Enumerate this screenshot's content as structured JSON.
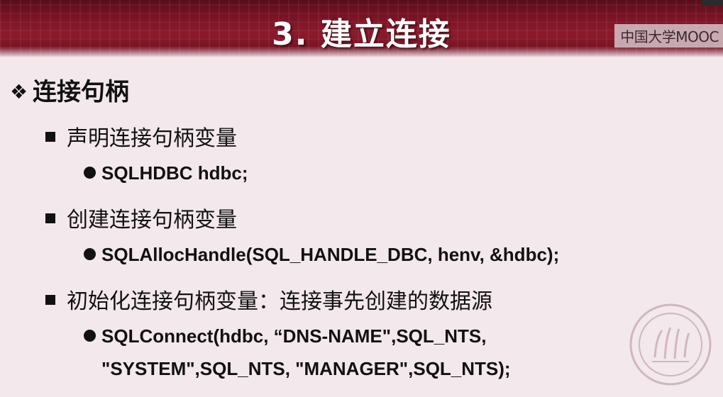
{
  "slide": {
    "title": "3. 建立连接",
    "watermark": "中国大学MOOC",
    "heading": "连接句柄",
    "items": [
      {
        "text": "声明连接句柄变量",
        "sub": [
          "SQLHDBC hdbc;"
        ]
      },
      {
        "text": "创建连接句柄变量",
        "sub": [
          "SQLAllocHandle(SQL_HANDLE_DBC, henv, &hdbc);"
        ]
      },
      {
        "text": "初始化连接句柄变量：连接事先创建的数据源",
        "sub": [
          "SQLConnect(hdbc, “DNS-NAME\",SQL_NTS,",
          "\"SYSTEM\",SQL_NTS, \"MANAGER\",SQL_NTS);"
        ]
      }
    ]
  },
  "icons": {
    "heading_bullet": "diamond-bullet-icon",
    "level2_bullet": "square-bullet-icon",
    "level3_bullet": "round-bullet-icon",
    "seal": "university-seal-icon"
  },
  "colors": {
    "header": "#7d1526",
    "background": "#f3e8ec",
    "text": "#111111"
  }
}
